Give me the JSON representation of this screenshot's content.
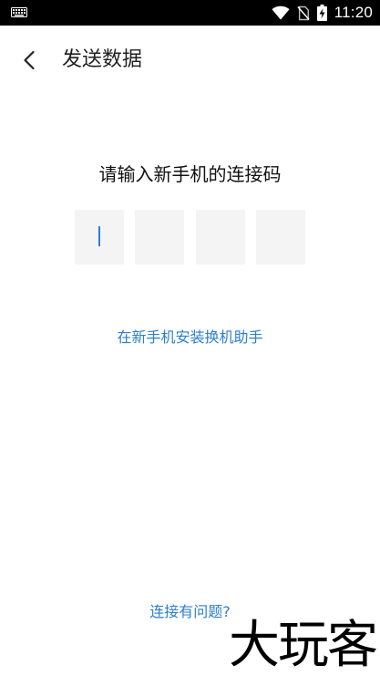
{
  "status_bar": {
    "time": "11:20",
    "icons": [
      "keyboard-icon",
      "wifi-icon",
      "no-sim-icon",
      "battery-charging-icon"
    ]
  },
  "toolbar": {
    "back_icon": "chevron-left-icon",
    "title": "发送数据"
  },
  "main": {
    "prompt": "请输入新手机的连接码",
    "code_inputs": [
      {
        "value": "",
        "focused": true
      },
      {
        "value": "",
        "focused": false
      },
      {
        "value": "",
        "focused": false
      },
      {
        "value": "",
        "focused": false
      }
    ],
    "install_link": "在新手机安装换机助手"
  },
  "footer": {
    "help_link": "连接有问题?"
  },
  "watermark": {
    "text": "大玩客"
  },
  "colors": {
    "status_bar_bg": "#000000",
    "link": "#2d7fc9",
    "caret": "#2a7fd4",
    "input_bg": "#f4f4f4"
  }
}
